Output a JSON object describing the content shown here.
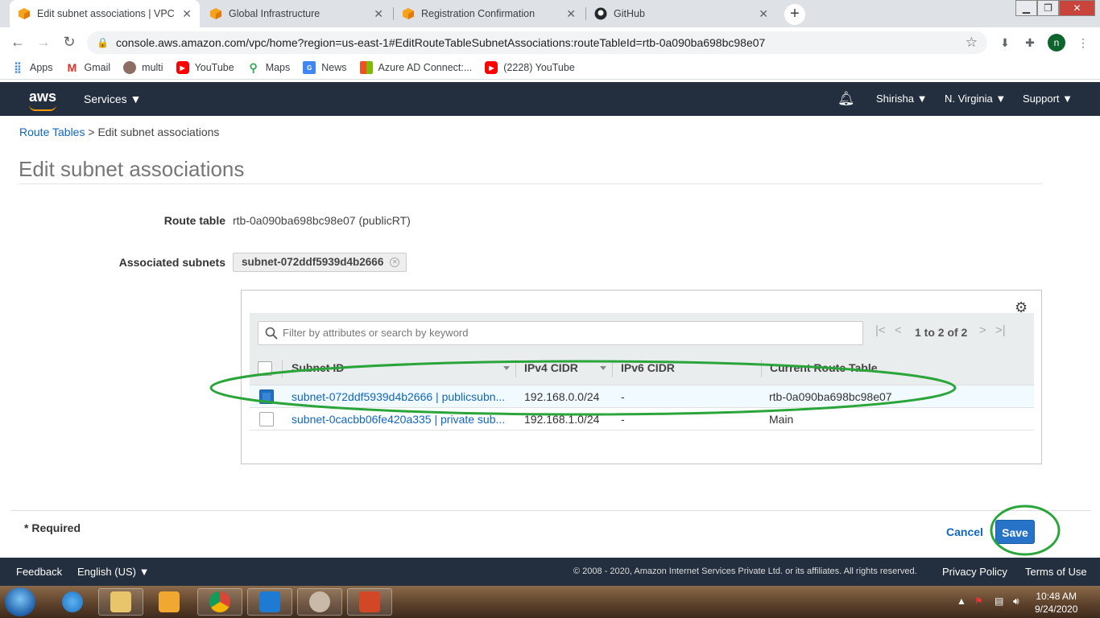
{
  "browser": {
    "tabs": [
      {
        "title": "Edit subnet associations | VPC M",
        "active": true
      },
      {
        "title": "Global Infrastructure",
        "active": false
      },
      {
        "title": "Registration Confirmation",
        "active": false
      },
      {
        "title": "GitHub",
        "active": false
      }
    ],
    "url": "console.aws.amazon.com/vpc/home?region=us-east-1#EditRouteTableSubnetAssociations:routeTableId=rtb-0a090ba698bc98e07",
    "profile_initial": "n",
    "bookmarks": [
      {
        "label": "Apps"
      },
      {
        "label": "Gmail"
      },
      {
        "label": "multi"
      },
      {
        "label": "YouTube"
      },
      {
        "label": "Maps"
      },
      {
        "label": "News"
      },
      {
        "label": "Azure AD Connect:..."
      },
      {
        "label": "(2228) YouTube"
      }
    ]
  },
  "aws_nav": {
    "logo": "aws",
    "services": "Services ▼",
    "user": "Shirisha ▼",
    "region": "N. Virginia ▼",
    "support": "Support ▼"
  },
  "breadcrumb": {
    "parent": "Route Tables",
    "separator": " > ",
    "current": "Edit subnet associations"
  },
  "page": {
    "title": "Edit subnet associations",
    "route_table_label": "Route table",
    "route_table_value": "rtb-0a090ba698bc98e07 (publicRT)",
    "associated_label": "Associated subnets",
    "associated_token": "subnet-072ddf5939d4b2666"
  },
  "table": {
    "filter_placeholder": "Filter by attributes or search by keyword",
    "pagination": "1 to 2 of 2",
    "columns": [
      "Subnet ID",
      "IPv4 CIDR",
      "IPv6 CIDR",
      "Current Route Table"
    ],
    "rows": [
      {
        "subnet": "subnet-072ddf5939d4b2666 | publicsubn...",
        "ipv4": "192.168.0.0/24",
        "ipv6": "-",
        "route_table": "rtb-0a090ba698bc98e07",
        "checked": true
      },
      {
        "subnet": "subnet-0cacbb06fe420a335 | private sub...",
        "ipv4": "192.168.1.0/24",
        "ipv6": "-",
        "route_table": "Main",
        "checked": false
      }
    ]
  },
  "form_footer": {
    "required": "* Required",
    "cancel": "Cancel",
    "save": "Save"
  },
  "aws_footer": {
    "feedback": "Feedback",
    "language": "English (US) ▼",
    "copyright": "© 2008 - 2020, Amazon Internet Services Private Ltd. or its affiliates. All rights reserved.",
    "privacy": "Privacy Policy",
    "terms": "Terms of Use"
  },
  "taskbar": {
    "time": "10:48 AM",
    "date": "9/24/2020"
  },
  "colors": {
    "aws_nav": "#232f3e",
    "link": "#1166bb",
    "primary_button": "#2773c7",
    "annotation": "#2aa53a"
  }
}
